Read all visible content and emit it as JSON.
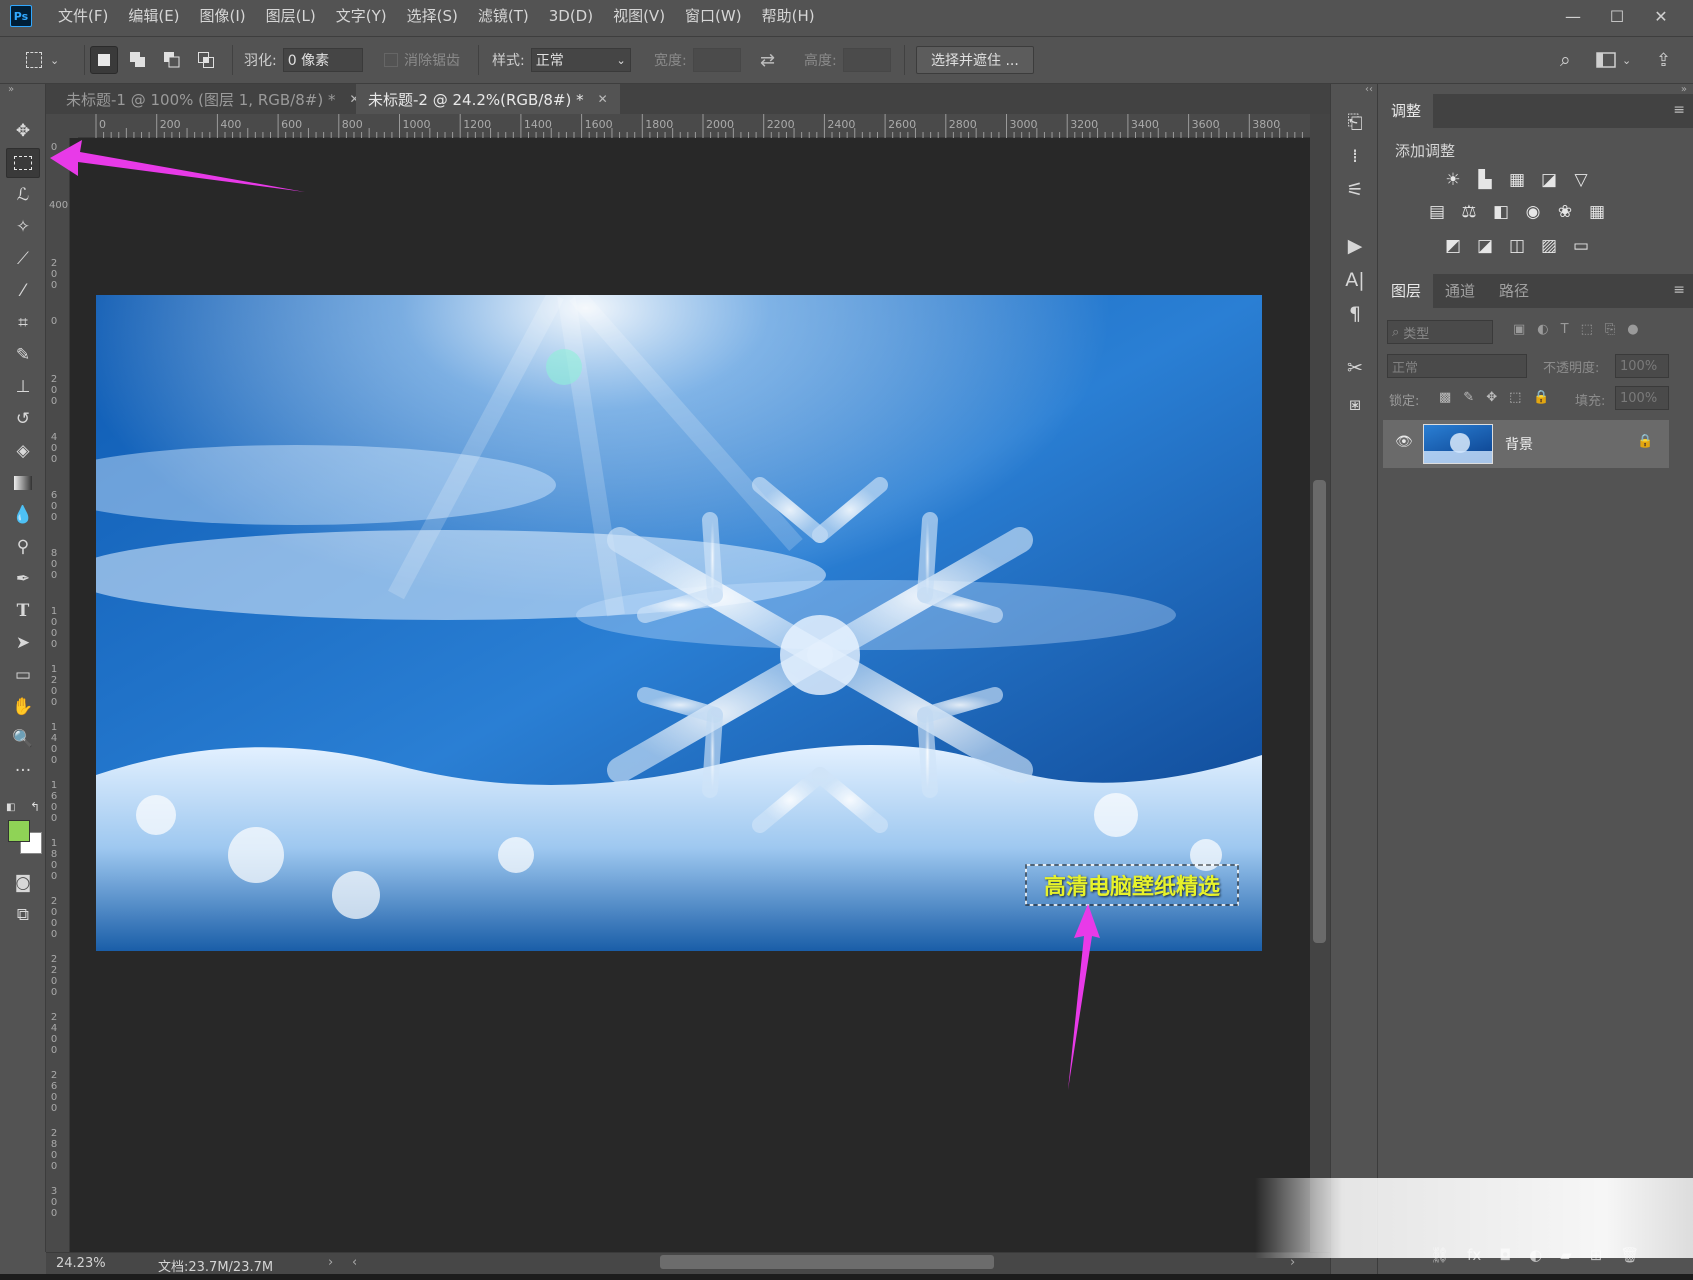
{
  "app": {
    "logo": "Ps"
  },
  "menu": [
    "文件(F)",
    "编辑(E)",
    "图像(I)",
    "图层(L)",
    "文字(Y)",
    "选择(S)",
    "滤镜(T)",
    "3D(D)",
    "视图(V)",
    "窗口(W)",
    "帮助(H)"
  ],
  "window_controls": [
    "—",
    "☐",
    "✕"
  ],
  "options": {
    "feather_label": "羽化:",
    "feather_value": "0 像素",
    "antialias_label": "消除锯齿",
    "style_label": "样式:",
    "style_value": "正常",
    "width_label": "宽度:",
    "height_label": "高度:",
    "select_mask_button": "选择并遮住 ..."
  },
  "tabs": [
    {
      "label": "未标题-1 @ 100% (图层 1, RGB/8#) *",
      "close": "✕"
    },
    {
      "label": "未标题-2 @ 24.2%(RGB/8#) *",
      "close": "✕"
    }
  ],
  "ruler": {
    "h_ticks": [
      "0",
      "200",
      "400",
      "600",
      "800",
      "1000",
      "1200",
      "1400",
      "1600",
      "1800",
      "2000",
      "2200",
      "2400",
      "2600",
      "2800",
      "3000",
      "3200",
      "3400",
      "3600",
      "3800"
    ],
    "v_ticks": [
      "0",
      "400",
      "2 0 0",
      "0",
      "2 0 0",
      "4 0 0",
      "6 0 0",
      "8 0 0",
      "1 0 0 0",
      "1 2 0 0",
      "1 4 0 0",
      "1 6 0 0",
      "1 8 0 0",
      "2 0 0 0",
      "2 2 0 0",
      "2 4 0 0",
      "2 6 0 0",
      "2 8 0 0",
      "3 0 0"
    ]
  },
  "image": {
    "watermark_text": "高清电脑壁纸精选"
  },
  "status": {
    "zoom": "24.23%",
    "doc": "文档:23.7M/23.7M"
  },
  "adjustments": {
    "tab": "调整",
    "add_label": "添加调整",
    "row1": [
      "☀",
      "▙",
      "▦",
      "◪",
      "▽"
    ],
    "row2": [
      "▤",
      "⚖",
      "◧",
      "◉",
      "❀",
      "▦"
    ],
    "row3": [
      "◩",
      "◪",
      "◫",
      "▨",
      "▭"
    ]
  },
  "layers_panel": {
    "tabs": [
      "图层",
      "通道",
      "路径"
    ],
    "filter_label": "类型",
    "blend_mode": "正常",
    "opacity_label": "不透明度:",
    "opacity_value": "100%",
    "lock_label": "锁定:",
    "fill_label": "填充:",
    "fill_value": "100%",
    "layer_name": "背景"
  },
  "colors": {
    "accent_arrow": "#e83ae8",
    "foreground": "#8fd356",
    "background": "#ffffff",
    "photo_text": "#e7f22a"
  }
}
